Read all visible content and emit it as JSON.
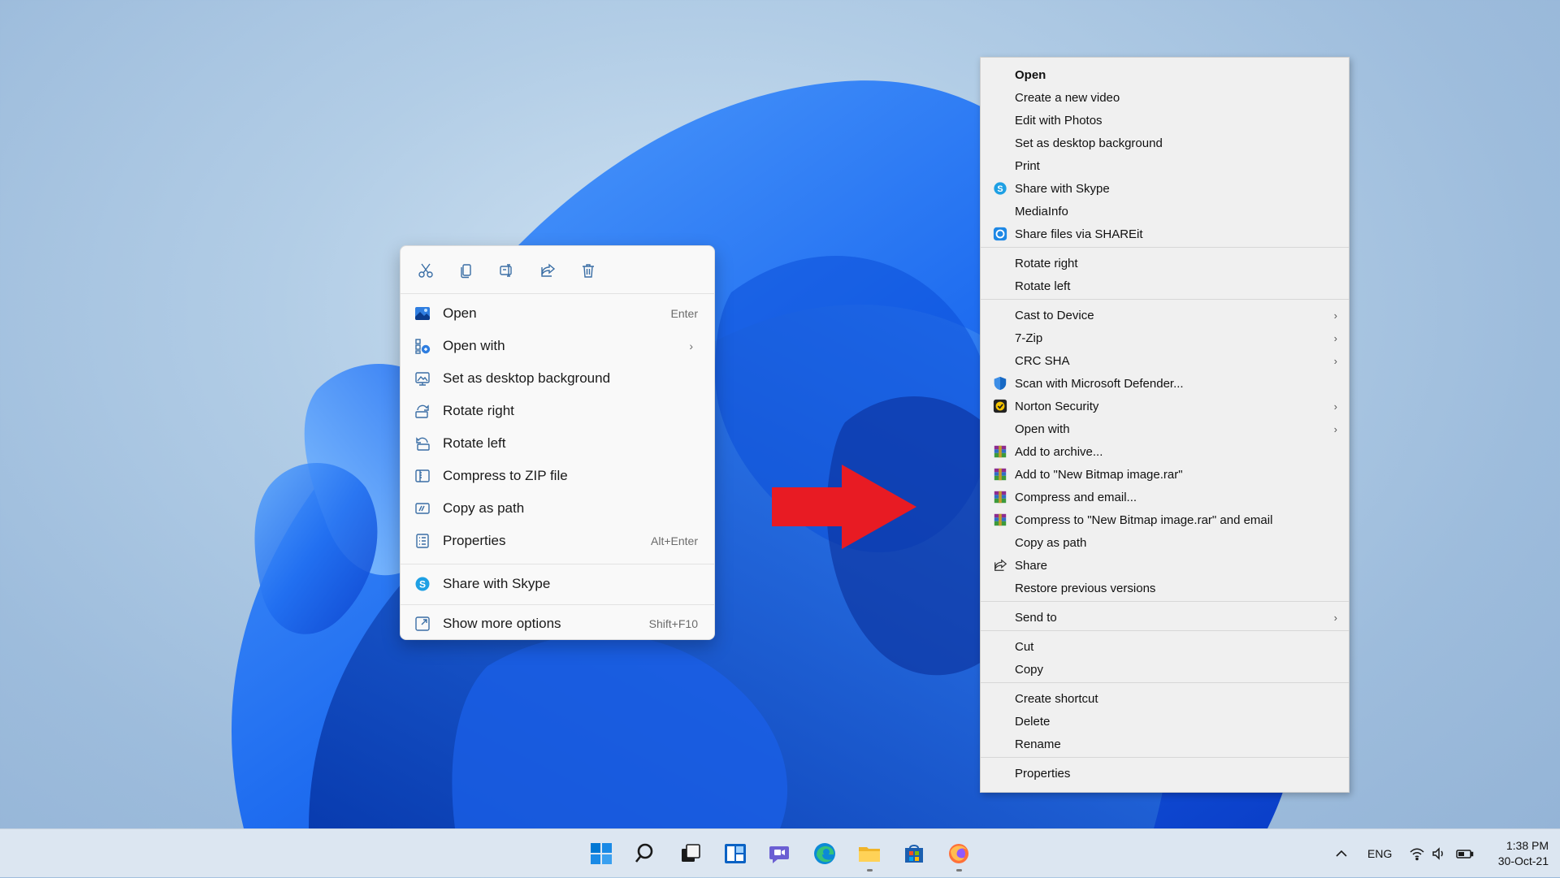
{
  "modern_menu": {
    "toolbar": [
      "cut-icon",
      "copy-icon",
      "rename-icon",
      "share-icon",
      "delete-icon"
    ],
    "items": [
      {
        "label": "Open",
        "shortcut": "Enter",
        "icon": "image-icon"
      },
      {
        "label": "Open with",
        "shortcut": "",
        "icon": "open-with-icon",
        "submenu": true
      },
      {
        "label": "Set as desktop background",
        "shortcut": "",
        "icon": "desktop-background-icon"
      },
      {
        "label": "Rotate right",
        "shortcut": "",
        "icon": "rotate-right-icon"
      },
      {
        "label": "Rotate left",
        "shortcut": "",
        "icon": "rotate-left-icon"
      },
      {
        "label": "Compress to ZIP file",
        "shortcut": "",
        "icon": "zip-icon"
      },
      {
        "label": "Copy as path",
        "shortcut": "",
        "icon": "copy-path-icon"
      },
      {
        "label": "Properties",
        "shortcut": "Alt+Enter",
        "icon": "properties-icon"
      },
      {
        "label": "Share with Skype",
        "shortcut": "",
        "icon": "skype-icon"
      },
      {
        "label": "Show more options",
        "shortcut": "Shift+F10",
        "icon": "more-options-icon"
      }
    ]
  },
  "classic_menu": {
    "items": [
      {
        "label": "Open"
      },
      {
        "label": "Create a new video"
      },
      {
        "label": "Edit with Photos"
      },
      {
        "label": "Set as desktop background"
      },
      {
        "label": "Print"
      },
      {
        "label": "Share with Skype"
      },
      {
        "label": "MediaInfo"
      },
      {
        "label": "Share files via SHAREit"
      },
      {
        "label": "Rotate right"
      },
      {
        "label": "Rotate left"
      },
      {
        "label": "Cast to Device"
      },
      {
        "label": "7-Zip"
      },
      {
        "label": "CRC SHA"
      },
      {
        "label": "Scan with Microsoft Defender..."
      },
      {
        "label": "Norton Security"
      },
      {
        "label": "Open with"
      },
      {
        "label": "Add to archive..."
      },
      {
        "label": "Add to \"New Bitmap image.rar\""
      },
      {
        "label": "Compress and email..."
      },
      {
        "label": "Compress to \"New Bitmap image.rar\" and email"
      },
      {
        "label": "Copy as path"
      },
      {
        "label": "Share"
      },
      {
        "label": "Restore previous versions"
      },
      {
        "label": "Send to"
      },
      {
        "label": "Cut"
      },
      {
        "label": "Copy"
      },
      {
        "label": "Create shortcut"
      },
      {
        "label": "Delete"
      },
      {
        "label": "Rename"
      },
      {
        "label": "Properties"
      }
    ]
  },
  "taskbar": {
    "apps": [
      "start-icon",
      "search-icon",
      "task-view-icon",
      "widgets-icon",
      "teams-chat-icon",
      "edge-icon",
      "file-explorer-icon",
      "store-icon",
      "firefox-icon"
    ],
    "language": "ENG",
    "time": "1:38 PM",
    "date": "30-Oct-21"
  },
  "colors": {
    "accent": "#0067c0",
    "arrow": "#e81b23"
  }
}
